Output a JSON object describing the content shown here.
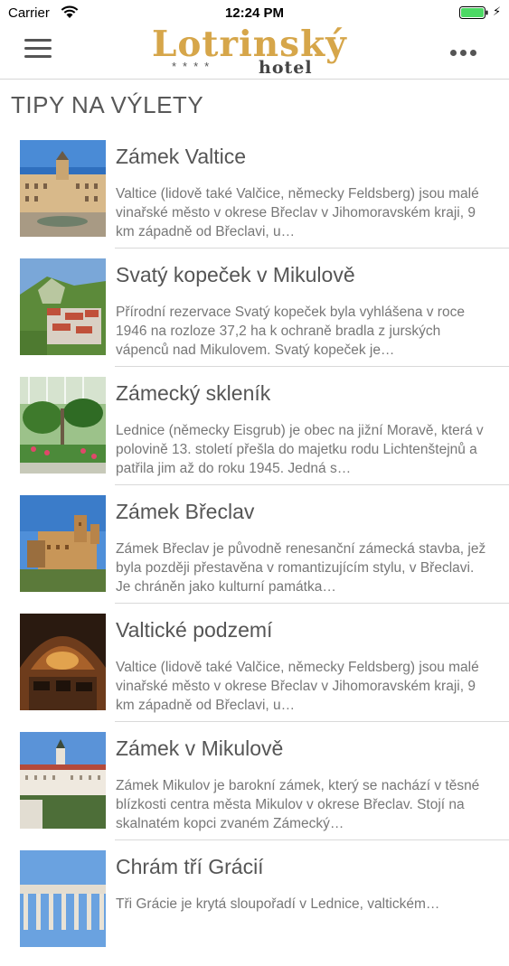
{
  "status_bar": {
    "carrier": "Carrier",
    "time": "12:24 PM"
  },
  "nav": {
    "logo_main": "Lotrinský",
    "logo_stars": "****",
    "logo_sub": "hotel",
    "menu_icon": "hamburger-menu-icon",
    "more_icon": "more-options-icon"
  },
  "section_title": "TIPY NA VÝLETY",
  "colors": {
    "logo_gold": "#d6a64a",
    "battery_green": "#4cd964"
  },
  "items": [
    {
      "title": "Zámek Valtice",
      "description": "Valtice (lidově také Valčice, německy Feldsberg) jsou malé vinařské město v okrese Břeclav v Jihomoravském kraji, 9 km západně od Břeclavi, u…"
    },
    {
      "title": "Svatý kopeček v Mikulově",
      "description": "Přírodní rezervace Svatý kopeček byla vyhlášena v roce 1946 na rozloze 37,2 ha k ochraně bradla z jurských vápenců nad Mikulovem. Svatý kopeček je…"
    },
    {
      "title": "Zámecký skleník",
      "description": "Lednice (německy Eisgrub) je obec na jižní Moravě, která v polovině 13. století přešla do majetku rodu Lichtenštejnů a patřila jim až do roku 1945. Jedná s…"
    },
    {
      "title": "Zámek Břeclav",
      "description": "Zámek Břeclav je původně renesanční zámecká stavba, jež byla později přestavěna v romantizujícím stylu, v Břeclavi. Je chráněn jako kulturní památka…"
    },
    {
      "title": "Valtické podzemí",
      "description": "Valtice (lidově také Valčice, německy Feldsberg) jsou malé vinařské město v okrese Břeclav v Jihomoravském kraji, 9 km západně od Břeclavi, u…"
    },
    {
      "title": "Zámek v Mikulově",
      "description": "Zámek Mikulov je barokní zámek, který se nachází v těsné blízkosti centra města Mikulov v okrese Břeclav. Stojí na skalnatém kopci zvaném Zámecký…"
    },
    {
      "title": "Chrám tří Grácií",
      "description": "Tři Grácie je krytá sloupořadí v Lednice, valtickém…"
    }
  ]
}
